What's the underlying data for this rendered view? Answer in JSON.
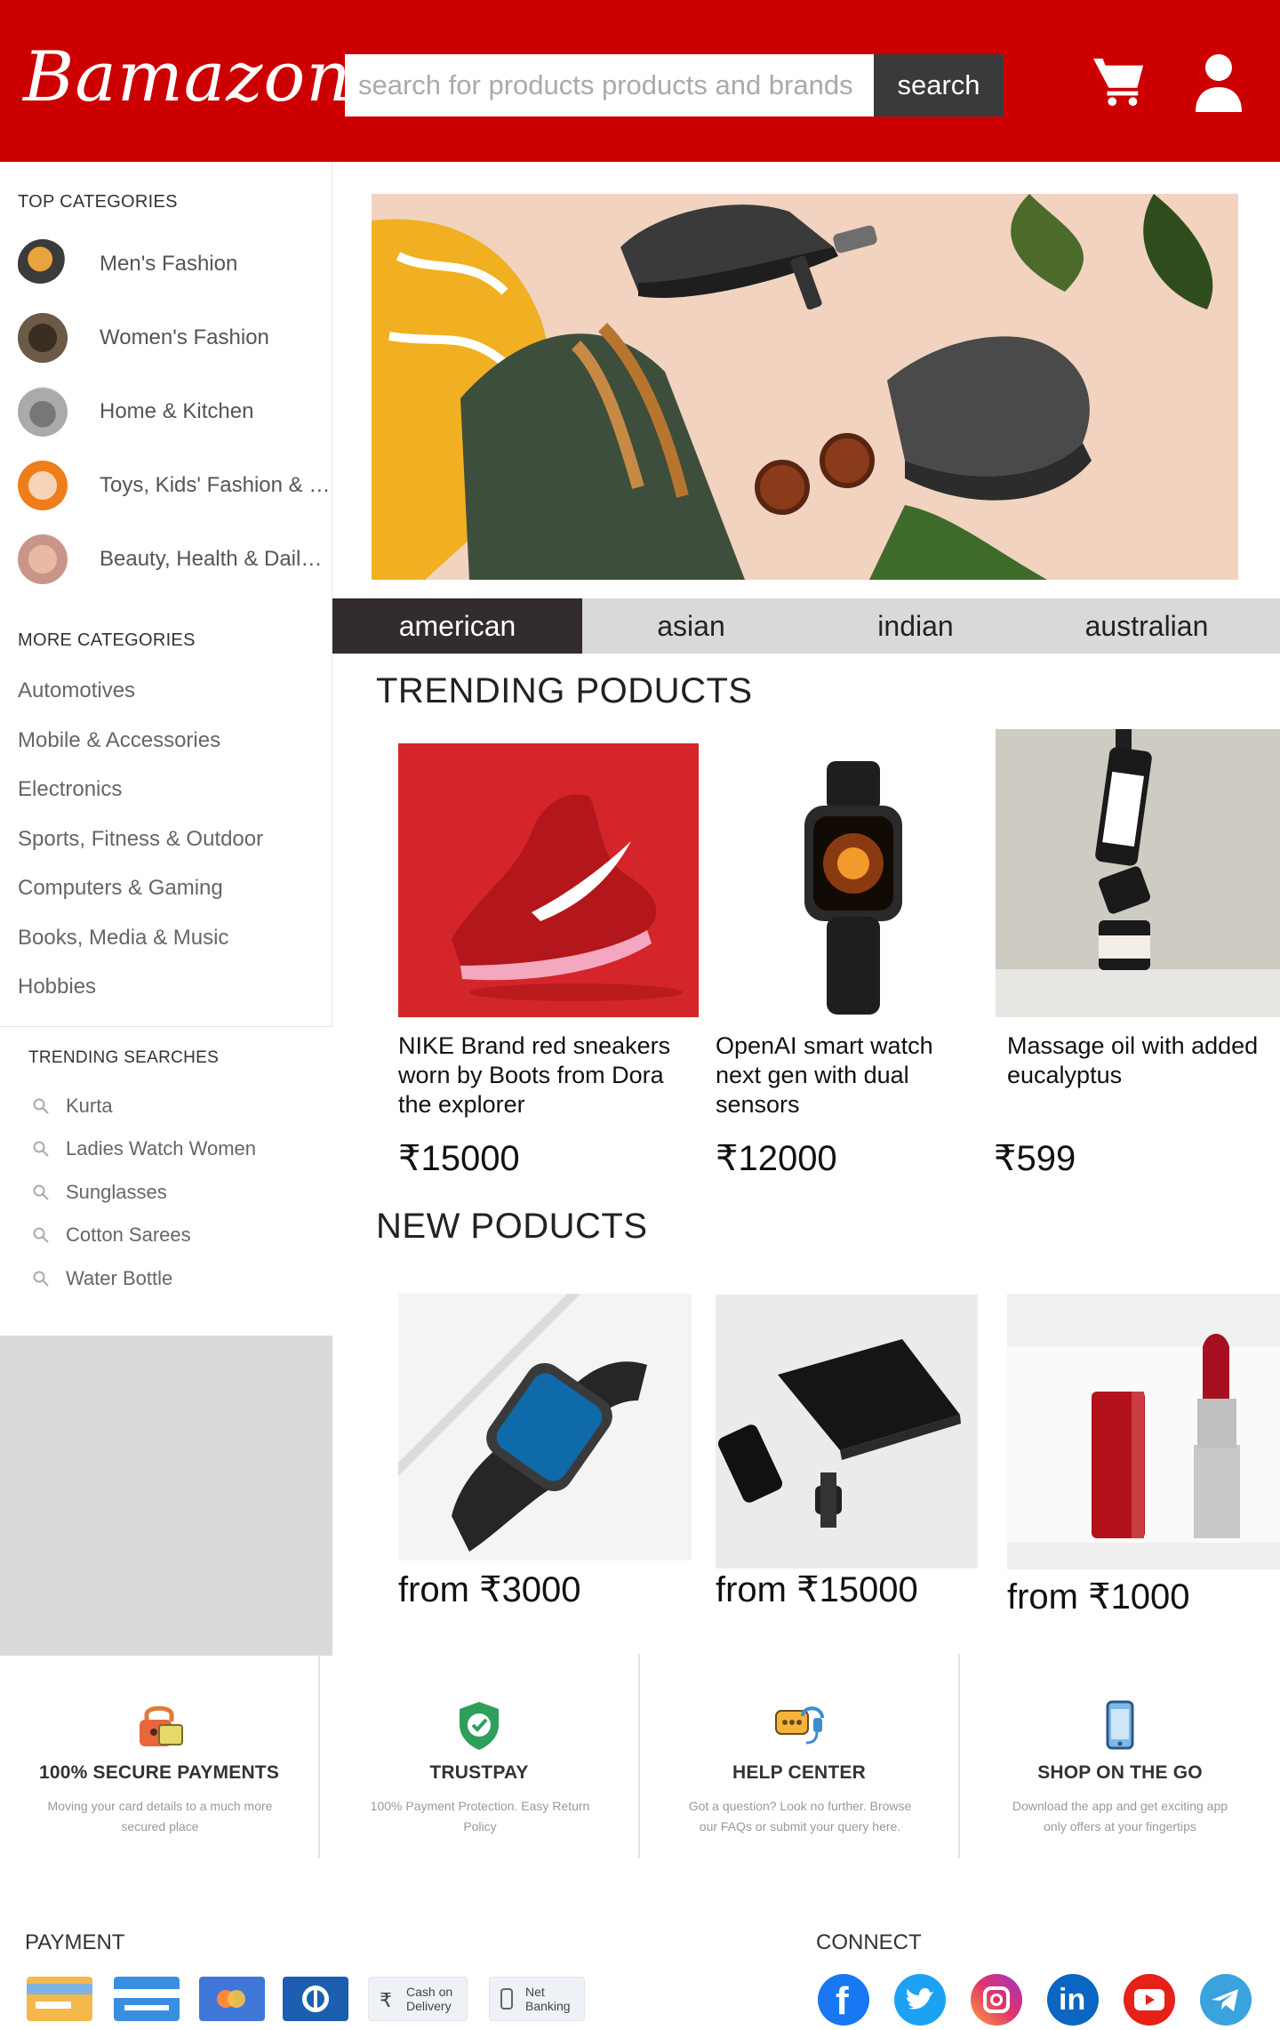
{
  "header": {
    "logo": "Bamazon",
    "search_placeholder": "search for products products and brands",
    "search_button": "search"
  },
  "sidebar": {
    "top_title": "TOP CATEGORIES",
    "top_categories": [
      "Men's Fashion",
      "Women's Fashion",
      "Home & Kitchen",
      "Toys, Kids' Fashion & more",
      "Beauty, Health & Daily Needs"
    ],
    "more_title": "MORE CATEGORIES",
    "more_categories": [
      "Automotives",
      "Mobile & Accessories",
      "Electronics",
      "Sports, Fitness & Outdoor",
      "Computers & Gaming",
      "Books, Media & Music",
      "Hobbies"
    ],
    "trending_title": "TRENDING SEARCHES",
    "trending_searches": [
      "Kurta",
      "Ladies Watch Women",
      "Sunglasses",
      "Cotton Sarees",
      "Water Bottle"
    ]
  },
  "tabs": [
    "american",
    "asian",
    "indian",
    "australian"
  ],
  "trending": {
    "title": "TRENDING PODUCTS",
    "products": [
      {
        "name": "NIKE Brand red sneakers worn by Boots from Dora the explorer",
        "price": "₹15000"
      },
      {
        "name": "OpenAI smart watch next gen with dual sensors",
        "price": "₹12000"
      },
      {
        "name": "Massage oil with added eucalyptus",
        "price": "₹599"
      }
    ]
  },
  "new_products": {
    "title": "NEW PODUCTS",
    "products": [
      {
        "price": "from ₹3000"
      },
      {
        "price": "from ₹15000"
      },
      {
        "price": "from ₹1000"
      }
    ]
  },
  "features": [
    {
      "title": "100% SECURE PAYMENTS",
      "desc": "Moving your card details to a much more secured place",
      "icon": "padlock-icon"
    },
    {
      "title": "TRUSTPAY",
      "desc": "100% Payment Protection. Easy Return Policy",
      "icon": "shield-check-icon"
    },
    {
      "title": "HELP CENTER",
      "desc": "Got a question? Look no further. Browse our FAQs or submit your query here.",
      "icon": "chat-headset-icon"
    },
    {
      "title": "SHOP ON THE GO",
      "desc": "Download the app and get exciting app only offers at your fingertips",
      "icon": "phone-icon"
    }
  ],
  "footer": {
    "payment_title": "PAYMENT",
    "payment_methods": [
      "Cash on Delivery",
      "Net Banking"
    ],
    "connect_title": "CONNECT"
  },
  "colors": {
    "brand": "#cc0000",
    "tab_active": "#332c2c",
    "search_button": "#3a3a3a"
  }
}
